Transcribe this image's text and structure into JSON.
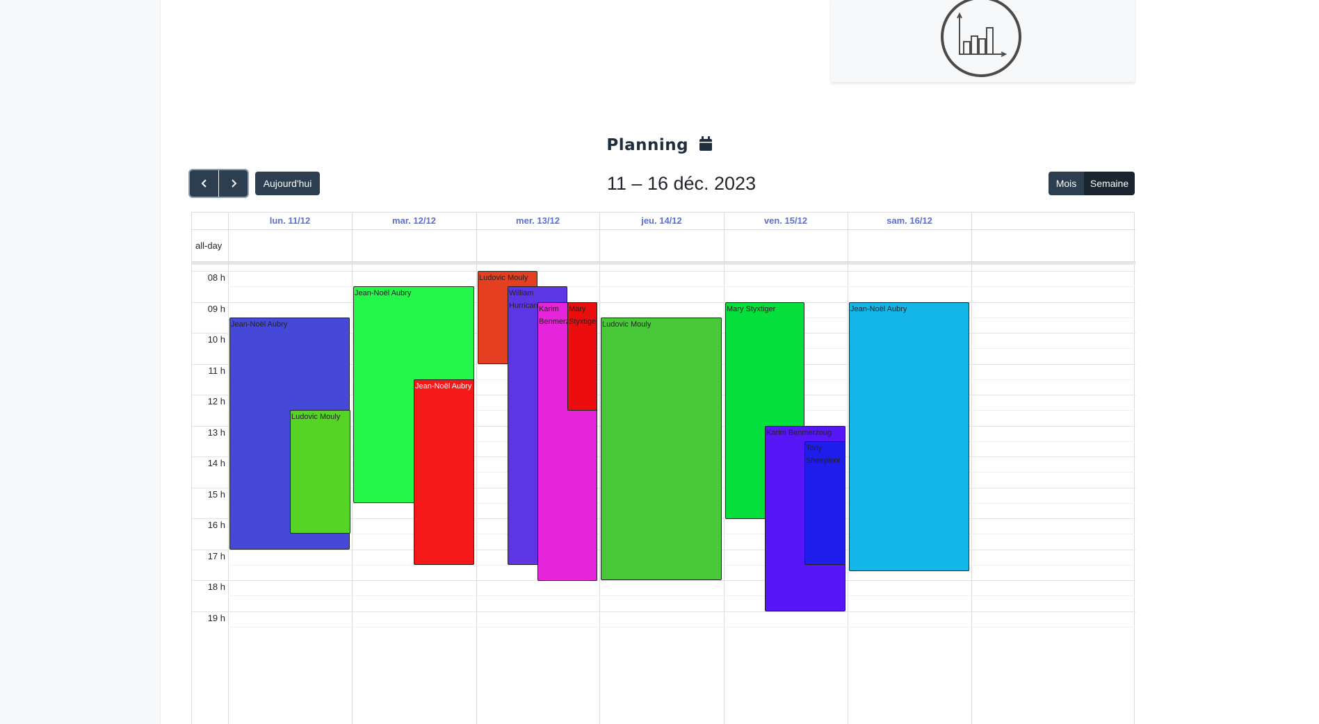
{
  "calendar": {
    "title": "Planning",
    "range_title": "11 – 16 déc. 2023",
    "today_label": "Aujourd'hui",
    "view_month_label": "Mois",
    "view_week_label": "Semaine",
    "allday_label": "all-day",
    "active_view": "Semaine",
    "days": [
      "lun. 11/12",
      "mar. 12/12",
      "mer. 13/12",
      "jeu. 14/12",
      "ven. 15/12",
      "sam. 16/12"
    ],
    "hours": [
      "08 h",
      "09 h",
      "10 h",
      "11 h",
      "12 h",
      "13 h",
      "14 h",
      "15 h",
      "16 h",
      "17 h",
      "18 h",
      "19 h"
    ],
    "events": [
      {
        "title": "Jean-Noël Aubry",
        "color": "#4648d8"
      },
      {
        "title": "Ludovic Mouly",
        "color": "#56d426"
      },
      {
        "title": "Jean-Noël Aubry",
        "color": "#24f74a"
      },
      {
        "title": "Jean-Noël Aubry",
        "color": "#f41818"
      },
      {
        "title": "Ludovic Mouly",
        "color": "#e33f20"
      },
      {
        "title": "William Hurricane",
        "color": "#5d35e3"
      },
      {
        "title": "Karim Benmerzoug",
        "color": "#e624d9"
      },
      {
        "title": "Mary Styxtiger",
        "color": "#ec0e0e"
      },
      {
        "title": "Ludovic Mouly",
        "color": "#49c93a"
      },
      {
        "title": "Mary Styxtiger",
        "color": "#06e03c"
      },
      {
        "title": "Karim Benmerzoug",
        "color": "#5616f6"
      },
      {
        "title": "Tony Sheepleoi",
        "color": "#1e1deb"
      },
      {
        "title": "Jean-Noël Aubry",
        "color": "#14b6e8"
      }
    ]
  },
  "stats_icon": "bar-chart-icon",
  "title_icon": "calendar-icon",
  "accent_color": "#2c3e50",
  "day_header_color": "#5b6fd3"
}
